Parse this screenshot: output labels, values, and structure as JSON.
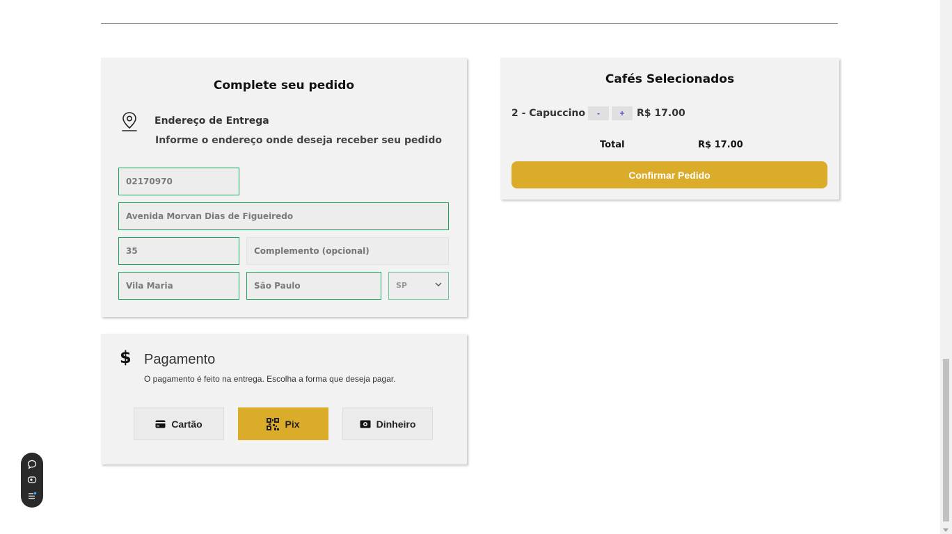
{
  "order_form": {
    "title": "Complete seu pedido",
    "address_heading": "Endereço de Entrega",
    "address_subtitle": "Informe o endereço onde deseja receber seu pedido",
    "fields": {
      "cep": "02170970",
      "street": "Avenida Morvan Dias de Figueiredo",
      "number": "35",
      "complement_placeholder": "Complemento (opcional)",
      "neighborhood": "Vila Maria",
      "city": "São Paulo",
      "state": "SP"
    }
  },
  "payment": {
    "heading": "Pagamento",
    "subtitle": "O pagamento é feito na entrega. Escolha a forma que deseja pagar.",
    "options": [
      {
        "label": "Cartão",
        "icon": "credit-card-icon",
        "selected": false
      },
      {
        "label": "Pix",
        "icon": "qr-code-icon",
        "selected": true
      },
      {
        "label": "Dinheiro",
        "icon": "cash-icon",
        "selected": false
      }
    ],
    "accent_color": "#dbac2a"
  },
  "cart": {
    "title": "Cafés Selecionados",
    "items": [
      {
        "label": "2 - Capuccino",
        "decrement": "-",
        "increment": "+",
        "price": "R$ 17.00"
      }
    ],
    "total_label": "Total",
    "total_value": "R$ 17.00",
    "confirm_label": "Confirmar Pedido"
  },
  "toolbar": {
    "icons": [
      "chat-icon",
      "eye-icon",
      "list-settings-icon"
    ]
  }
}
